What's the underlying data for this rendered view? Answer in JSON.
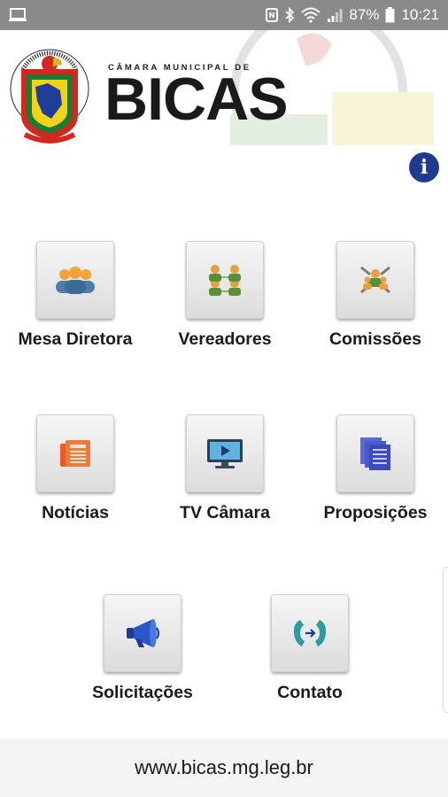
{
  "status_bar": {
    "battery": "87%",
    "time": "10:21",
    "icons": [
      "screenshot-icon",
      "nfc-icon",
      "bluetooth-icon",
      "wifi-icon",
      "signal-icon",
      "battery-icon"
    ]
  },
  "header": {
    "brand_small": "CÂMARA MUNICIPAL DE",
    "brand_big": "BICAS",
    "info_icon": "i"
  },
  "menu": {
    "mesa": {
      "label": "Mesa Diretora",
      "icon": "group-icon"
    },
    "vereadores": {
      "label": "Vereadores",
      "icon": "councillors-icon"
    },
    "comissoes": {
      "label": "Comissões",
      "icon": "committee-icon"
    },
    "noticias": {
      "label": "Notícias",
      "icon": "newspaper-icon"
    },
    "tv": {
      "label": "TV Câmara",
      "icon": "monitor-play-icon"
    },
    "proposicoes": {
      "label": "Proposições",
      "icon": "documents-icon"
    },
    "solicitacoes": {
      "label": "Solicitações",
      "icon": "megaphone-icon"
    },
    "contato": {
      "label": "Contato",
      "icon": "phone-icon"
    }
  },
  "footer": {
    "url": "www.bicas.mg.leg.br"
  },
  "colors": {
    "status_bar": "#8a8a8a",
    "info_button": "#1f3b8f",
    "footer_bg": "#f4f4f4"
  }
}
